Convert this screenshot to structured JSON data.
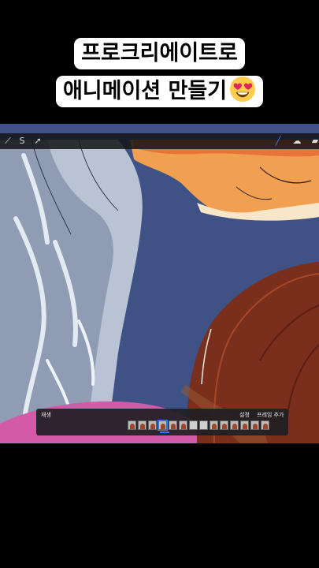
{
  "caption": {
    "line1": "프로크리에이트로",
    "line2": "애니메이션 만들기",
    "emoji_icon": "heart-eyes-emoji"
  },
  "procreate": {
    "toolbar": {
      "left_icons": [
        "actions-wand-icon",
        "selection-s-icon",
        "transform-arrow-icon"
      ],
      "right_icons": [
        "brush-icon",
        "smudge-icon",
        "eraser-icon"
      ],
      "accent": "#3b7bff"
    },
    "timeline": {
      "play_label": "재생",
      "settings_label": "설정",
      "add_frame_label": "프레임 추가",
      "frame_count": 14,
      "blank_frames": [
        6,
        7
      ],
      "current_frame": 3
    }
  }
}
